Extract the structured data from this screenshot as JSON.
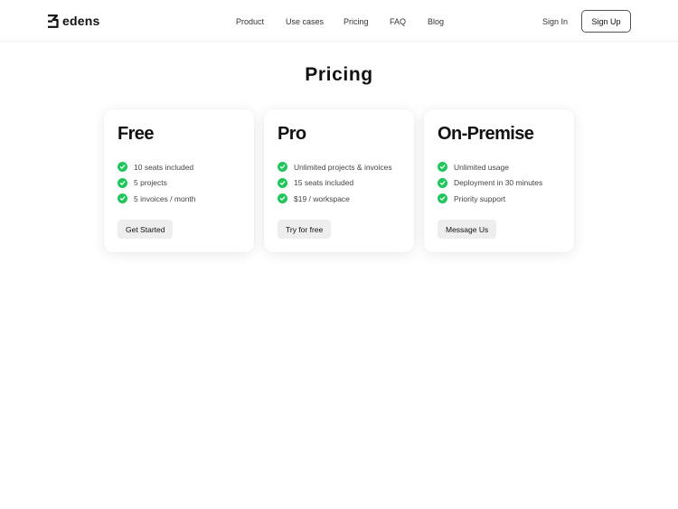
{
  "header": {
    "brand": "edens",
    "nav": [
      "Product",
      "Use cases",
      "Pricing",
      "FAQ",
      "Blog"
    ],
    "sign_in": "Sign In",
    "sign_up": "Sign Up"
  },
  "page": {
    "title": "Pricing"
  },
  "plans": [
    {
      "name": "Free",
      "features": [
        "10 seats included",
        "5 projects",
        "5 invoices / month"
      ],
      "cta": "Get Started"
    },
    {
      "name": "Pro",
      "features": [
        "Unlimited projects & invoices",
        "15 seats included",
        "$19 / workspace"
      ],
      "cta": "Try for free"
    },
    {
      "name": "On-Premise",
      "features": [
        "Unlimited usage",
        "Deployment in 30 minutes",
        "Priority support"
      ],
      "cta": "Message Us"
    }
  ],
  "colors": {
    "check": "#22c55e",
    "button_bg": "#eeeeee",
    "text": "#111111"
  },
  "icons": {
    "feature": "check-circle-icon",
    "logo": "edens-logo-icon"
  }
}
